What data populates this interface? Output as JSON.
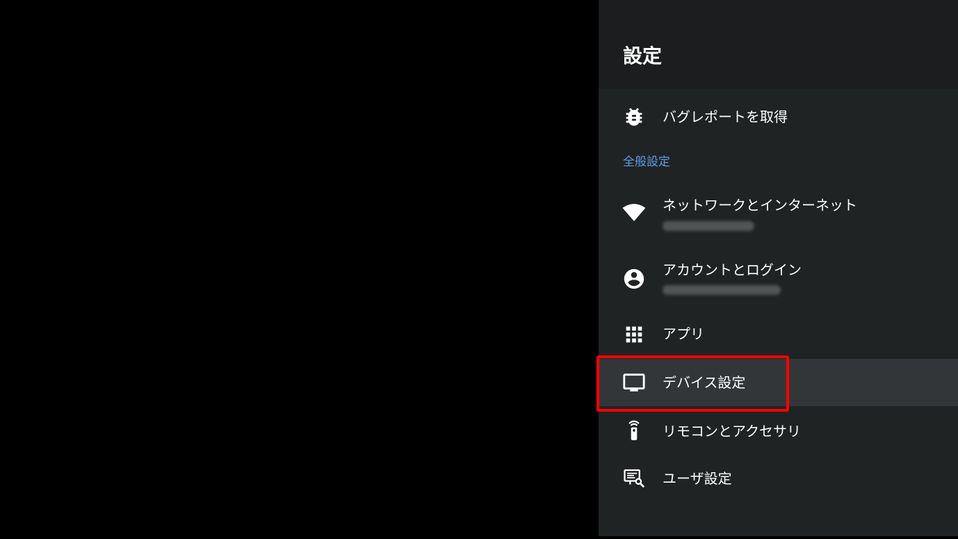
{
  "panel": {
    "title": "設定",
    "bug_report": {
      "label": "バグレポートを取得",
      "icon": "bug-icon"
    },
    "section_general": "全般設定",
    "items": [
      {
        "key": "network",
        "label": "ネットワークとインターネット",
        "icon": "wifi-icon",
        "has_redacted_subtitle": true
      },
      {
        "key": "accounts",
        "label": "アカウントとログイン",
        "icon": "account-circle-icon",
        "has_redacted_subtitle": true
      },
      {
        "key": "apps",
        "label": "アプリ",
        "icon": "apps-grid-icon",
        "has_redacted_subtitle": false
      },
      {
        "key": "device",
        "label": "デバイス設定",
        "icon": "tv-icon",
        "has_redacted_subtitle": false,
        "focused": true
      },
      {
        "key": "remotes",
        "label": "リモコンとアクセサリ",
        "icon": "remote-icon",
        "has_redacted_subtitle": false
      },
      {
        "key": "user",
        "label": "ユーザ設定",
        "icon": "user-settings-icon",
        "has_redacted_subtitle": false
      }
    ]
  },
  "colors": {
    "panel_background": "#202324",
    "header_background": "#1b1d1e",
    "focused_row": "#333638",
    "section_header": "#5c9ce6",
    "annotation_outline": "#ff0000"
  }
}
